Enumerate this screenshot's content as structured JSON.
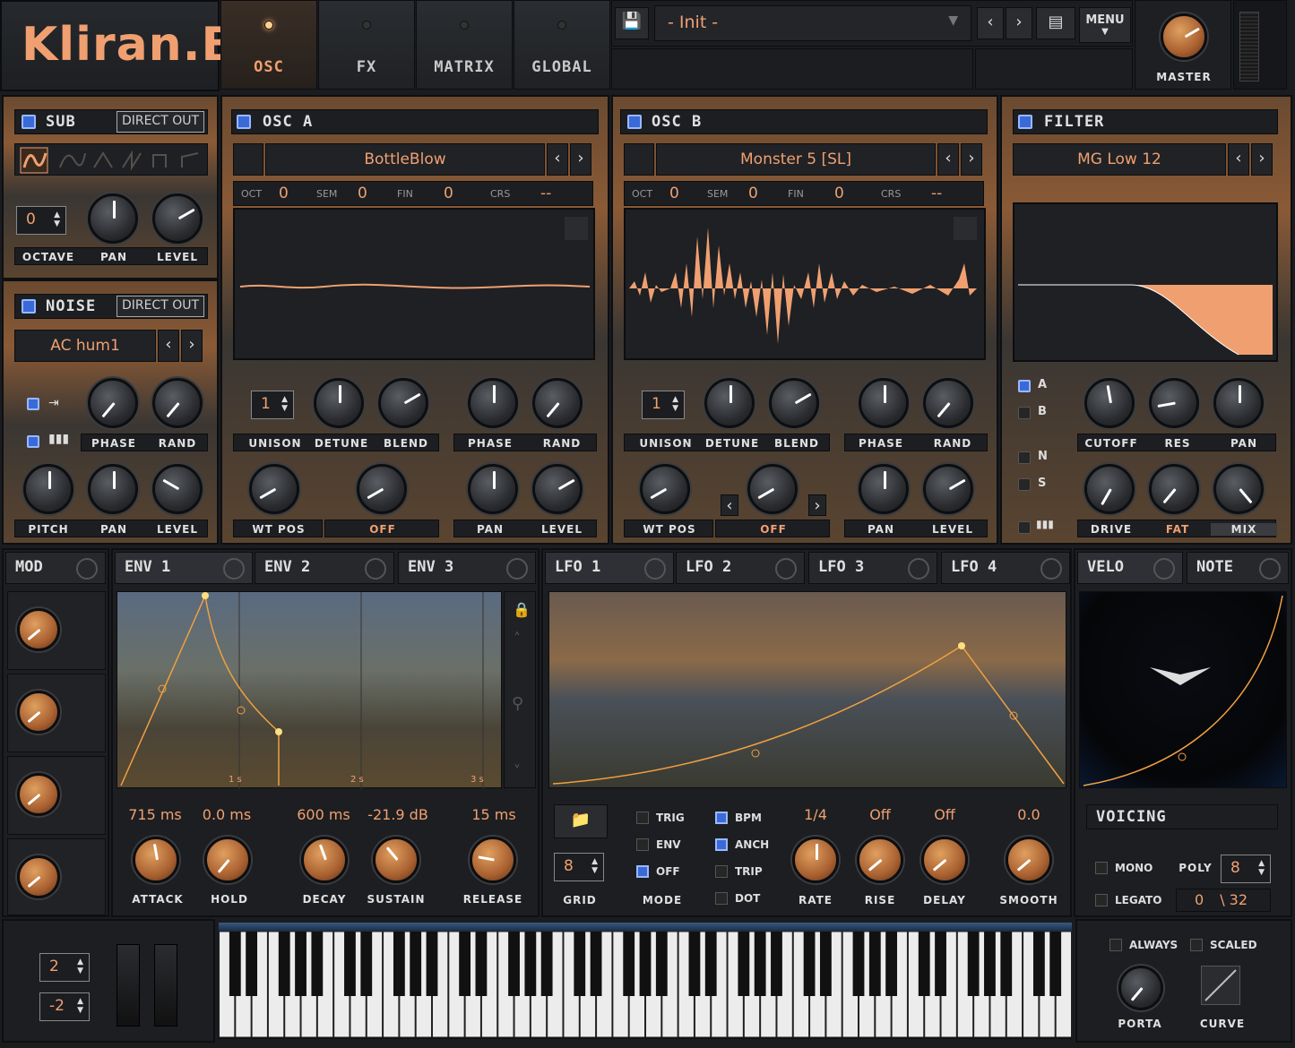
{
  "app": {
    "title": "Kliran.B"
  },
  "tabs": [
    {
      "label": "OSC",
      "active": true
    },
    {
      "label": "FX"
    },
    {
      "label": "MATRIX"
    },
    {
      "label": "GLOBAL"
    }
  ],
  "preset": {
    "name": "- Init -",
    "menu_label": "MENU",
    "master_label": "MASTER"
  },
  "sub": {
    "title": "SUB",
    "direct_out": "DIRECT OUT",
    "octave_value": "0",
    "labels": [
      "OCTAVE",
      "PAN",
      "LEVEL"
    ]
  },
  "noise": {
    "title": "NOISE",
    "direct_out": "DIRECT OUT",
    "type": "AC hum1",
    "labels_top": [
      "PHASE",
      "RAND"
    ],
    "labels_bottom": [
      "PITCH",
      "PAN",
      "LEVEL"
    ]
  },
  "osc_a": {
    "title": "OSC  A",
    "wavetable": "BottleBlow",
    "oct_label": "OCT",
    "oct": "0",
    "sem_label": "SEM",
    "sem": "0",
    "fin_label": "FIN",
    "fin": "0",
    "crs_label": "CRS",
    "crs": "--",
    "unison": "1",
    "labels_top": [
      "UNISON",
      "DETUNE",
      "BLEND",
      "PHASE",
      "RAND"
    ],
    "labels_bottom": [
      "WT POS",
      "OFF",
      "PAN",
      "LEVEL"
    ]
  },
  "osc_b": {
    "title": "OSC  B",
    "wavetable": "Monster 5 [SL]",
    "oct_label": "OCT",
    "oct": "0",
    "sem_label": "SEM",
    "sem": "0",
    "fin_label": "FIN",
    "fin": "0",
    "crs_label": "CRS",
    "crs": "--",
    "unison": "1",
    "labels_top": [
      "UNISON",
      "DETUNE",
      "BLEND",
      "PHASE",
      "RAND"
    ],
    "labels_bottom": [
      "WT POS",
      "OFF",
      "PAN",
      "LEVEL"
    ]
  },
  "filter": {
    "title": "FILTER",
    "type": "MG Low 12",
    "routes": [
      "A",
      "B",
      "N",
      "S"
    ],
    "labels_top": [
      "CUTOFF",
      "RES",
      "PAN"
    ],
    "labels_bottom": [
      "DRIVE",
      "FAT",
      "MIX"
    ]
  },
  "mod": {
    "title": "MOD"
  },
  "env_tabs": [
    "ENV 1",
    "ENV 2",
    "ENV 3"
  ],
  "env_grid": [
    "1 s",
    "2 s",
    "3 s"
  ],
  "env": {
    "values": [
      "715 ms",
      "0.0 ms",
      "600 ms",
      "-21.9 dB",
      "15 ms"
    ],
    "labels": [
      "ATTACK",
      "HOLD",
      "DECAY",
      "SUSTAIN",
      "RELEASE"
    ]
  },
  "lfo_tabs": [
    "LFO 1",
    "LFO 2",
    "LFO 3",
    "LFO 4"
  ],
  "lfo": {
    "grid": "8",
    "grid_label": "GRID",
    "mode_label": "MODE",
    "mode_options": [
      "TRIG",
      "ENV",
      "OFF"
    ],
    "flags": [
      "BPM",
      "ANCH",
      "TRIP",
      "DOT"
    ],
    "values": [
      "1/4",
      "Off",
      "Off",
      "0.0"
    ],
    "labels": [
      "RATE",
      "RISE",
      "DELAY",
      "SMOOTH"
    ]
  },
  "velo_tabs": [
    "VELO",
    "NOTE"
  ],
  "voicing": {
    "title": "VOICING",
    "mono": "MONO",
    "legato": "LEGATO",
    "poly_label": "POLY",
    "poly": "8",
    "range": "0",
    "range2": "\\ 32"
  },
  "keyboard": {
    "bend_up": "2",
    "bend_down": "-2"
  },
  "porta": {
    "always": "ALWAYS",
    "scaled": "SCALED",
    "porta_label": "PORTA",
    "curve_label": "CURVE"
  }
}
